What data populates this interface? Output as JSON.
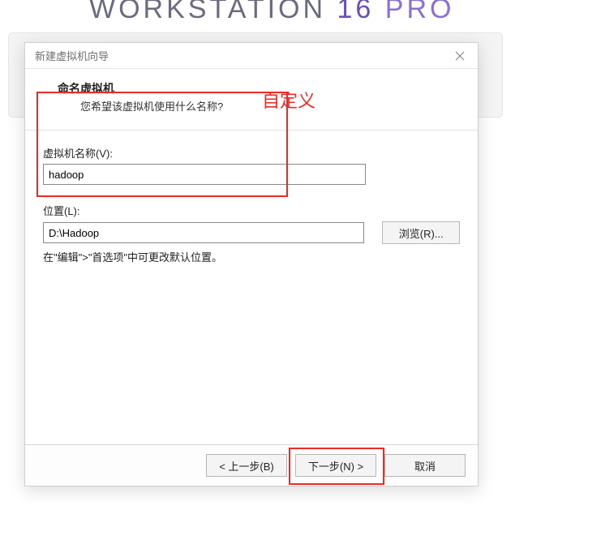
{
  "branding": {
    "text1": "WORKSTATION ",
    "num": "16",
    "text2": " PRO"
  },
  "dialog": {
    "title": "新建虚拟机向导",
    "header": {
      "title": "命名虚拟机",
      "subtitle": "您希望该虚拟机使用什么名称?"
    },
    "annotation": "自定义",
    "fields": {
      "name_label": "虚拟机名称(V):",
      "name_value": "hadoop",
      "location_label": "位置(L):",
      "location_value": "D:\\Hadoop",
      "browse_label": "浏览(R)...",
      "hint": "在\"编辑\">\"首选项\"中可更改默认位置。"
    },
    "buttons": {
      "back": "< 上一步(B)",
      "next": "下一步(N) >",
      "cancel": "取消"
    }
  }
}
